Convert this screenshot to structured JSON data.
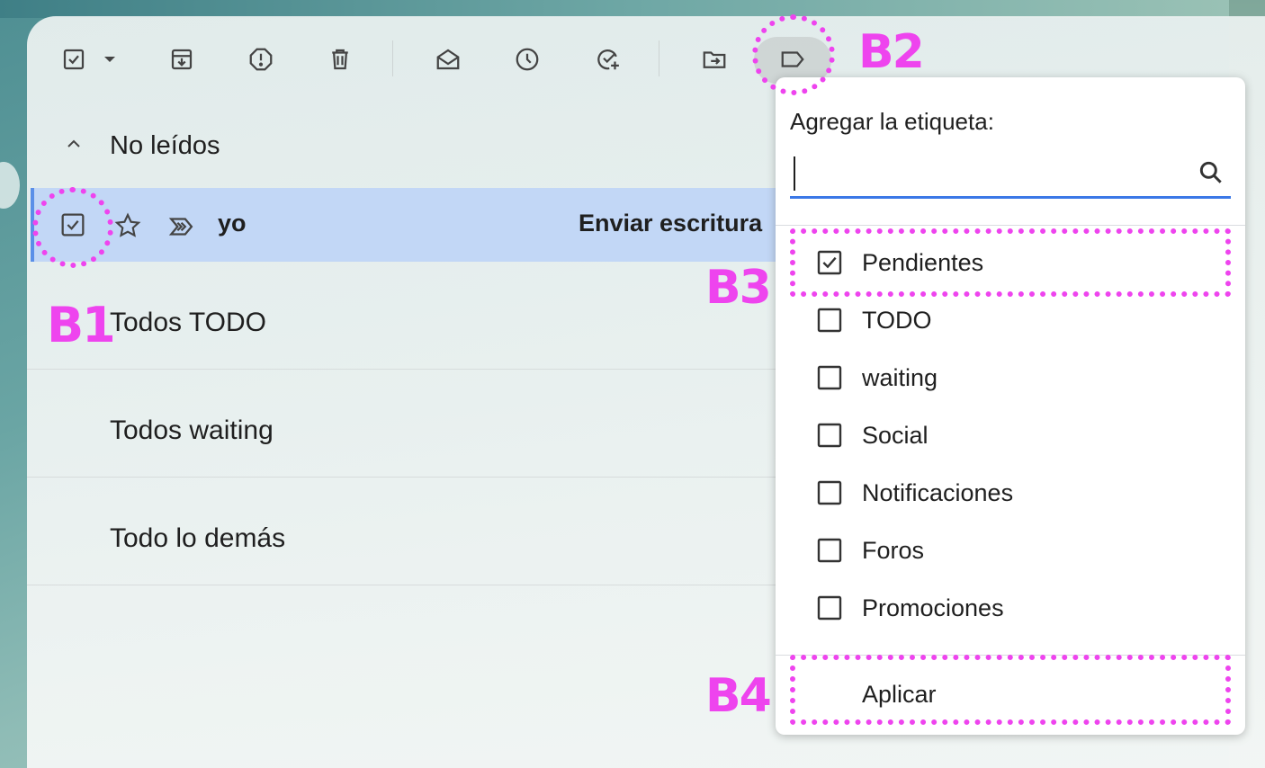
{
  "toolbar": {
    "icons": [
      "select-checkbox-icon",
      "select-dropdown-icon",
      "archive-icon",
      "report-spam-icon",
      "delete-icon",
      "mark-read-icon",
      "snooze-icon",
      "add-to-tasks-icon",
      "move-to-icon",
      "label-icon"
    ]
  },
  "section": {
    "title": "No leídos"
  },
  "mail": {
    "sender": "yo",
    "subject": "Enviar escritura"
  },
  "categories": [
    {
      "label": "Todos TODO"
    },
    {
      "label": "Todos waiting"
    },
    {
      "label": "Todo lo demás"
    }
  ],
  "label_menu": {
    "title": "Agregar la etiqueta:",
    "search_value": "",
    "options": [
      {
        "label": "Pendientes",
        "checked": true
      },
      {
        "label": "TODO",
        "checked": false
      },
      {
        "label": "waiting",
        "checked": false
      },
      {
        "label": "Social",
        "checked": false
      },
      {
        "label": "Notificaciones",
        "checked": false
      },
      {
        "label": "Foros",
        "checked": false
      },
      {
        "label": "Promociones",
        "checked": false
      }
    ],
    "apply_label": "Aplicar"
  },
  "annotations": {
    "b1": "B1",
    "b2": "B2",
    "b3": "B3",
    "b4": "B4"
  },
  "colors": {
    "annotation": "#ee44ee",
    "selected_row": "#c2d7f6",
    "search_underline": "#3b78e7"
  }
}
